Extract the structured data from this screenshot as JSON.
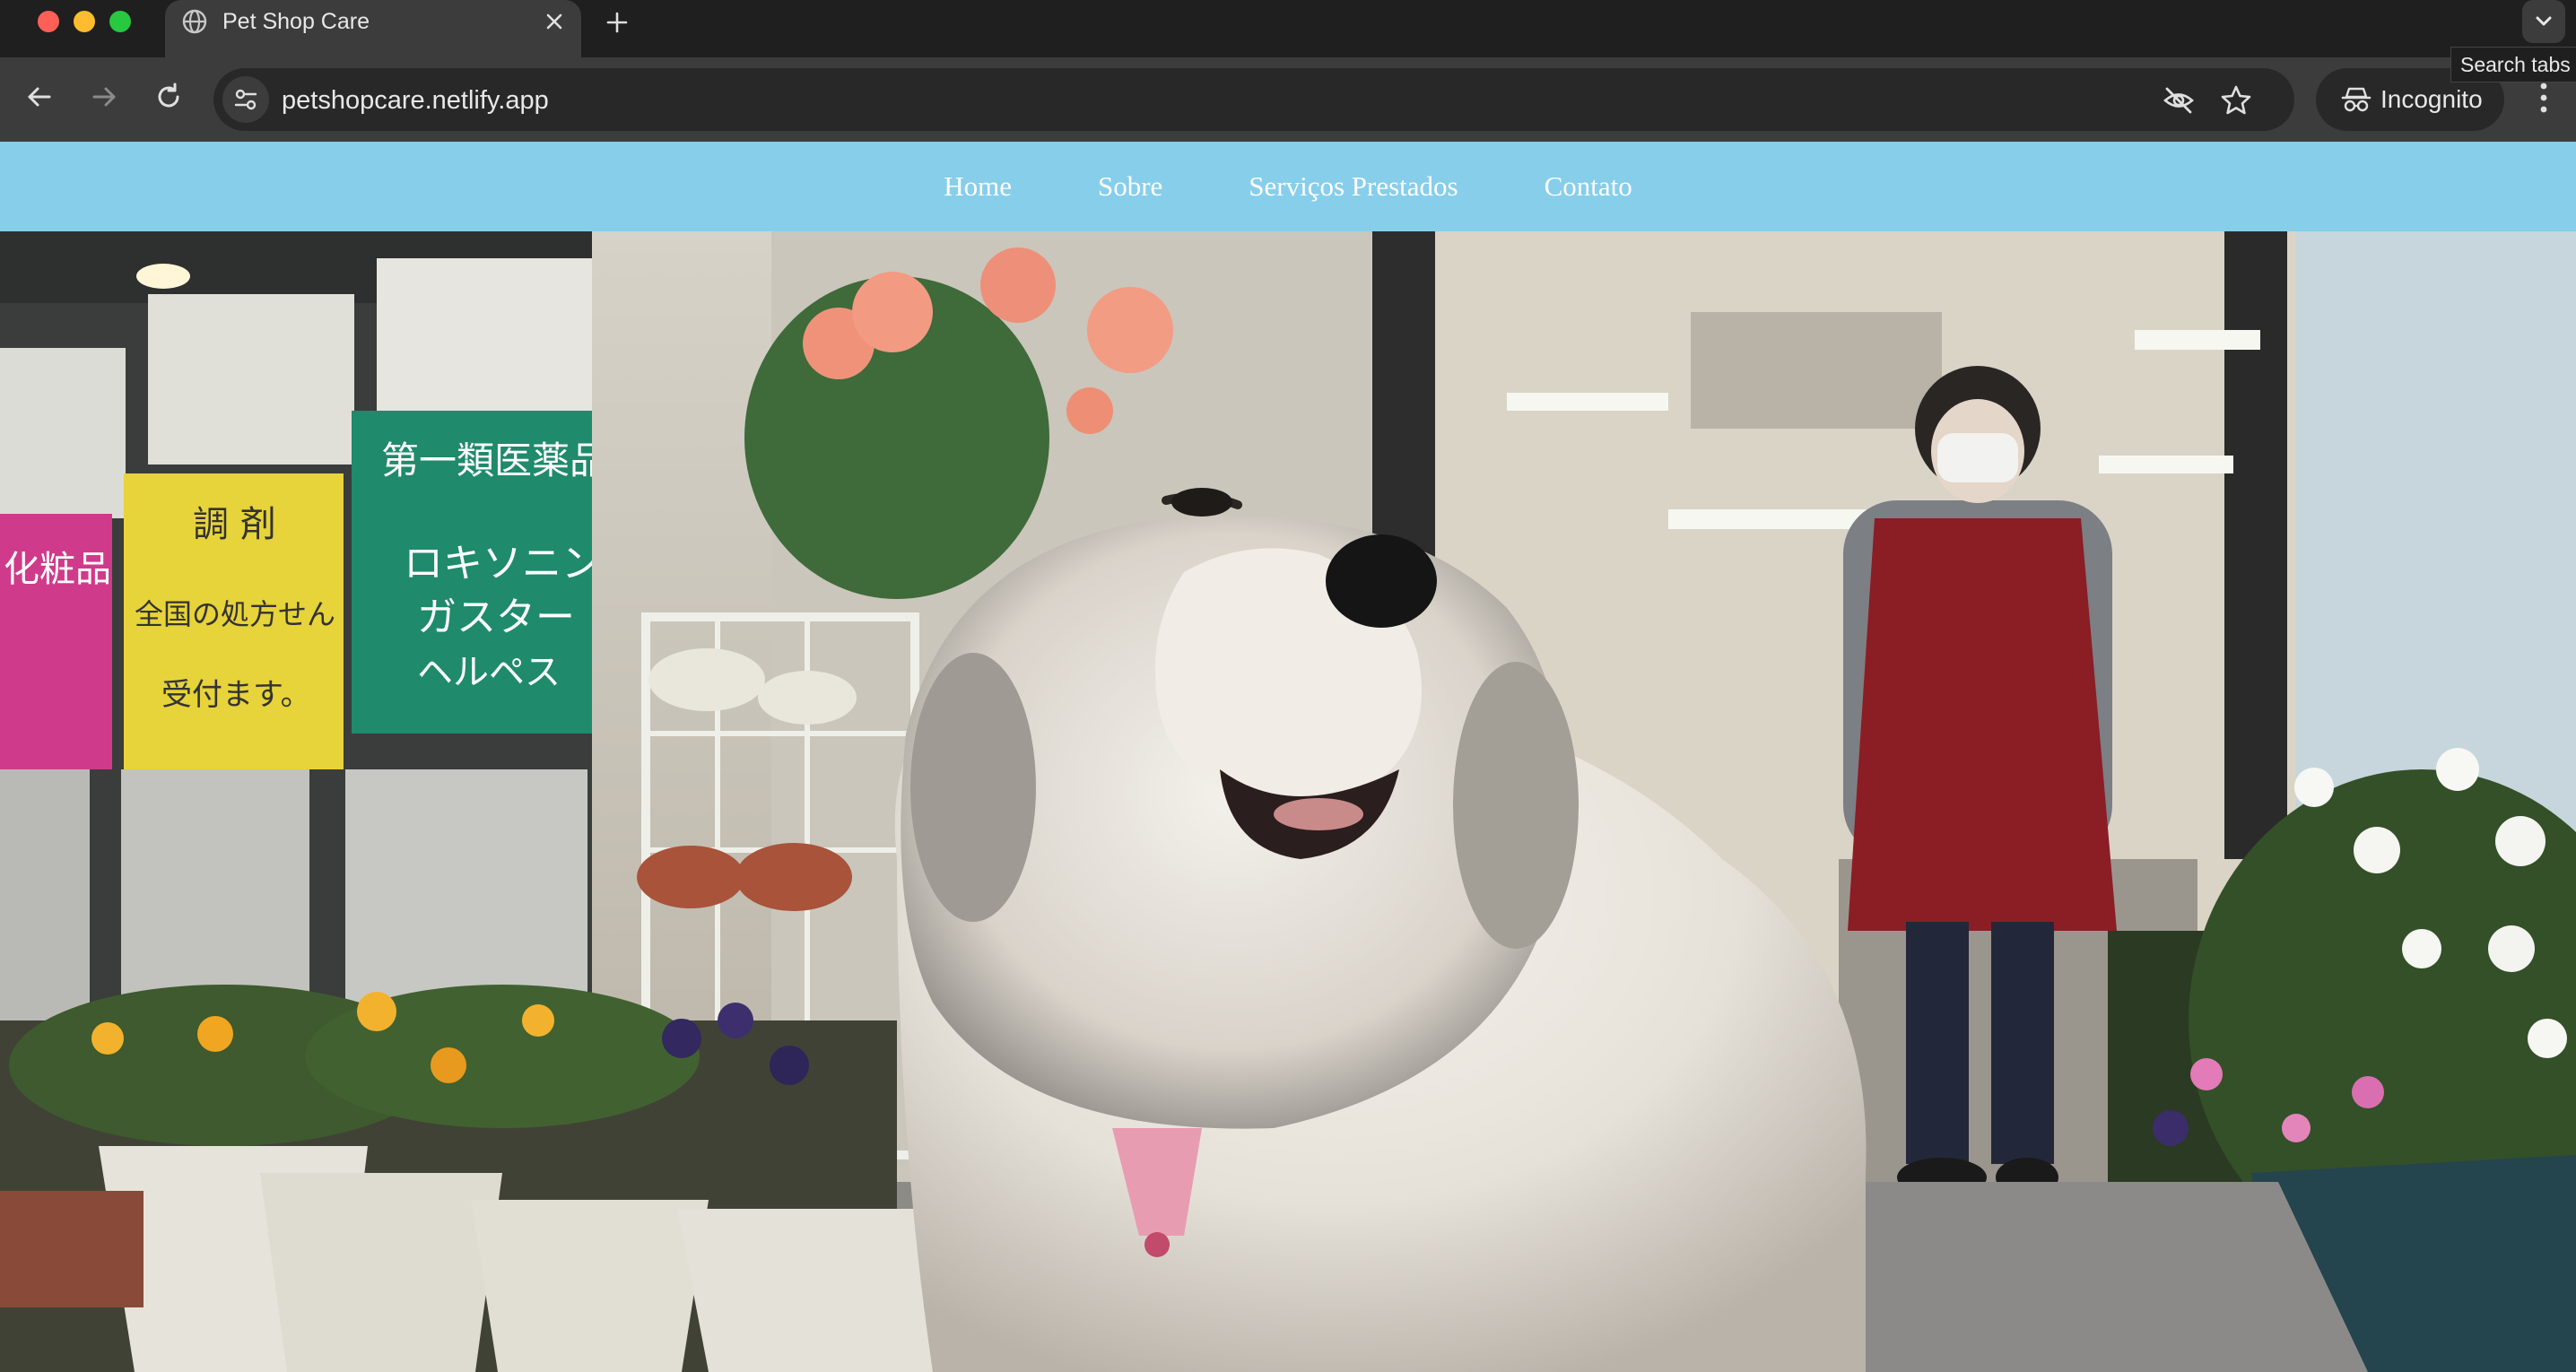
{
  "browser": {
    "tab": {
      "title": "Pet Shop Care",
      "favicon": "globe-icon",
      "close_icon": "close-icon"
    },
    "new_tab_icon": "plus-icon",
    "tab_search": {
      "icon": "chevron-down-icon",
      "tooltip": "Search tabs"
    },
    "toolbar": {
      "back_icon": "arrow-left-icon",
      "forward_icon": "arrow-right-icon",
      "reload_icon": "reload-icon",
      "site_info_icon": "tune-icon",
      "url": "petshopcare.netlify.app",
      "tracking_icon": "eye-slash-icon",
      "bookmark_icon": "star-icon",
      "incognito_label": "Incognito",
      "incognito_icon": "incognito-icon",
      "menu_icon": "kebab-menu-icon"
    }
  },
  "site": {
    "nav": {
      "background": "#87ceeb",
      "items": [
        {
          "label": "Home"
        },
        {
          "label": "Sobre"
        },
        {
          "label": "Serviços Prestados"
        },
        {
          "label": "Contato"
        }
      ]
    },
    "hero": {
      "subject": "hero-photo"
    },
    "sign_text": {
      "pink": "化粧品",
      "yellow": [
        "調 剤",
        "全国の処方せん",
        "受付ます。"
      ],
      "green": [
        "第一類医薬品",
        "ロキソニン",
        "ガスター",
        "ヘルペス"
      ]
    }
  },
  "colors": {
    "chrome_dark": "#1f1f1f",
    "chrome_toolbar": "#3c3c3c",
    "omnibox": "#282828",
    "nav_text": "#ffffff"
  }
}
